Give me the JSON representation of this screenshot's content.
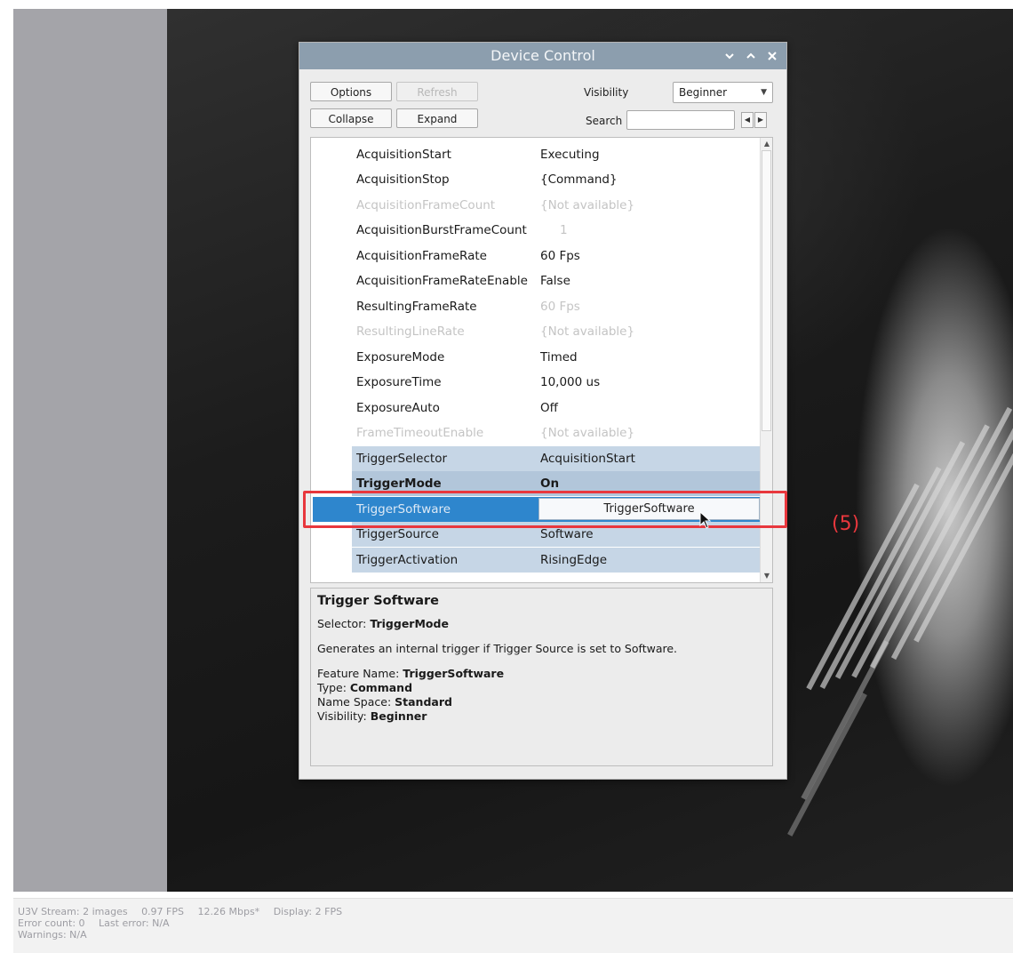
{
  "dialog": {
    "title": "Device Control",
    "buttons": {
      "options": "Options",
      "refresh": "Refresh",
      "collapse": "Collapse",
      "expand": "Expand"
    },
    "visibility_label": "Visibility",
    "visibility_value": "Beginner",
    "search_label": "Search",
    "search_value": ""
  },
  "features": [
    {
      "name": "AcquisitionStart",
      "value": "Executing"
    },
    {
      "name": "AcquisitionStop",
      "value": "{Command}"
    },
    {
      "name": "AcquisitionFrameCount",
      "value": "{Not available}"
    },
    {
      "name": "AcquisitionBurstFrameCount",
      "value": "1"
    },
    {
      "name": "AcquisitionFrameRate",
      "value": "60 Fps"
    },
    {
      "name": "AcquisitionFrameRateEnable",
      "value": "False"
    },
    {
      "name": "ResultingFrameRate",
      "value": "60 Fps"
    },
    {
      "name": "ResultingLineRate",
      "value": "{Not available}"
    },
    {
      "name": "ExposureMode",
      "value": "Timed"
    },
    {
      "name": "ExposureTime",
      "value": "10,000 us"
    },
    {
      "name": "ExposureAuto",
      "value": "Off"
    },
    {
      "name": "FrameTimeoutEnable",
      "value": "{Not available}"
    },
    {
      "name": "TriggerSelector",
      "value": "AcquisitionStart"
    },
    {
      "name": "TriggerMode",
      "value": "On"
    },
    {
      "name": "TriggerSoftware",
      "value": "TriggerSoftware"
    },
    {
      "name": "TriggerSource",
      "value": "Software"
    },
    {
      "name": "TriggerActivation",
      "value": "RisingEdge"
    }
  ],
  "description": {
    "title": "Trigger Software",
    "selector_label": "Selector:",
    "selector_value": "TriggerMode",
    "text": "Generates an internal trigger if Trigger Source is set to Software.",
    "feature_name_label": "Feature Name:",
    "feature_name_value": "TriggerSoftware",
    "type_label": "Type:",
    "type_value": "Command",
    "namespace_label": "Name Space:",
    "namespace_value": "Standard",
    "visibility_label": "Visibility:",
    "visibility_value": "Beginner"
  },
  "annotation": {
    "step": "(5)",
    "color": "#e8373d"
  },
  "status": {
    "stream": "U3V Stream: 2 images",
    "fps": "0.97 FPS",
    "bandwidth": "12.26 Mbps*",
    "display": "Display: 2 FPS",
    "errors": "Error count: 0",
    "last_error": "Last error: N/A",
    "warnings": "Warnings: N/A"
  },
  "icons": [
    "chevron-down-icon",
    "chevron-up-icon",
    "close-icon",
    "dropdown-arrow-icon",
    "scroll-up-icon",
    "scroll-down-icon",
    "mouse-cursor-icon"
  ]
}
